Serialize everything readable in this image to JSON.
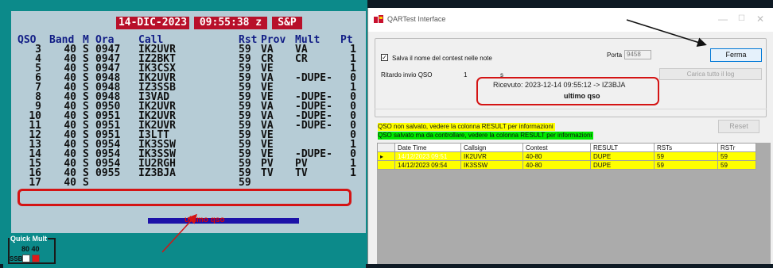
{
  "logger": {
    "header_date": "14-DIC-2023",
    "header_time": "09:55:38 z",
    "header_mode": "S&P",
    "columns": [
      "QSO",
      "Band",
      "M",
      "Ora",
      "Call",
      "Rst",
      "Prov",
      "Mult",
      "Pt"
    ],
    "rows": [
      [
        "3",
        "40",
        "S",
        "0947",
        "IK2UVR",
        "59",
        "VA",
        "VA",
        "1"
      ],
      [
        "4",
        "40",
        "S",
        "0947",
        "IZ2BKT",
        "59",
        "CR",
        "CR",
        "1"
      ],
      [
        "5",
        "40",
        "S",
        "0947",
        "IK3CSX",
        "59",
        "VE",
        "",
        "1"
      ],
      [
        "6",
        "40",
        "S",
        "0948",
        "IK2UVR",
        "59",
        "VA",
        "-DUPE-",
        "0"
      ],
      [
        "7",
        "40",
        "S",
        "0948",
        "IZ3SSB",
        "59",
        "VE",
        "",
        "1"
      ],
      [
        "8",
        "40",
        "S",
        "0948",
        "I3VAD",
        "59",
        "VE",
        "-DUPE-",
        "0"
      ],
      [
        "9",
        "40",
        "S",
        "0950",
        "IK2UVR",
        "59",
        "VA",
        "-DUPE-",
        "0"
      ],
      [
        "10",
        "40",
        "S",
        "0951",
        "IK2UVR",
        "59",
        "VA",
        "-DUPE-",
        "0"
      ],
      [
        "11",
        "40",
        "S",
        "0951",
        "IK2UVR",
        "59",
        "VA",
        "-DUPE-",
        "0"
      ],
      [
        "12",
        "40",
        "S",
        "0951",
        "I3LTT",
        "59",
        "VE",
        "",
        "0"
      ],
      [
        "13",
        "40",
        "S",
        "0954",
        "IK3SSW",
        "59",
        "VE",
        "",
        "1"
      ],
      [
        "14",
        "40",
        "S",
        "0954",
        "IK3SSW",
        "59",
        "VE",
        "-DUPE-",
        "0"
      ],
      [
        "15",
        "40",
        "S",
        "0954",
        "IU2RGH",
        "59",
        "PV",
        "PV",
        "1"
      ],
      [
        "16",
        "40",
        "S",
        "0955",
        "IZ3BJA",
        "59",
        "TV",
        "TV",
        "1"
      ],
      [
        "17",
        "40",
        "S",
        "",
        "",
        "59",
        "",
        "",
        ""
      ]
    ],
    "annotation": "ultimo qso",
    "quick_mult": {
      "title": "Quick Mult",
      "bands": "80 40",
      "mode": "SSB",
      "status_colors": [
        "#ffffff",
        "#e01818"
      ]
    }
  },
  "qar": {
    "title": "QARTest Interface",
    "window_buttons": [
      "—",
      "☐",
      "✕"
    ],
    "checkbox_checked": true,
    "checkbox_label": "Salva il nome del contest nelle note",
    "porta_label": "Porta",
    "porta_value": "9458",
    "stop_button": "Ferma",
    "delay_label": "Ritardo invio QSO",
    "delay_value": "1",
    "delay_unit": "s",
    "load_log_button": "Carica tutto il log",
    "received_text": "Ricevuto: 2023-12-14 09:55:12 -> IZ3BJA",
    "annotation": "ultimo qso",
    "note_yellow": "QSO non salvato, vedere la colonna RESULT per informazioni",
    "note_green": "QSO salvato ma da controllare, vedere la colonna RESULT per informazioni",
    "reset_button": "Reset",
    "table": {
      "columns": [
        "Date Time",
        "Callsign",
        "Contest",
        "RESULT",
        "RSTs",
        "RSTr"
      ],
      "rows": [
        [
          "14/12/2023 09:51",
          "IK2UVR",
          "40-80",
          "DUPE",
          "59",
          "59"
        ],
        [
          "14/12/2023 09:54",
          "IK3SSW",
          "40-80",
          "DUPE",
          "59",
          "59"
        ]
      ],
      "row_color": "#ffff00",
      "selected_color": "#0078d7"
    },
    "colors": {
      "annotation_red": "#d41414",
      "logger_bg": "#0c8a8a"
    }
  }
}
